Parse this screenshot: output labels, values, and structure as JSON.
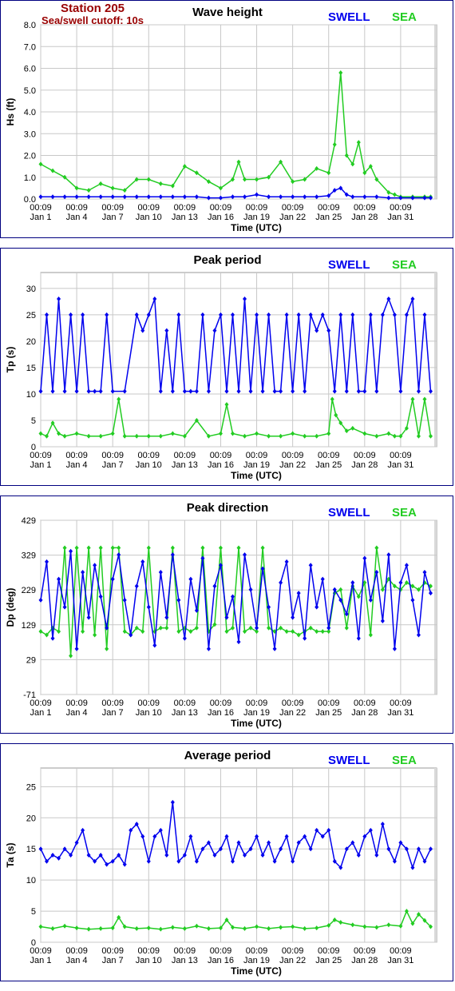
{
  "header": {
    "station": "Station 205",
    "cutoff": "Sea/swell cutoff: 10s"
  },
  "legend": {
    "swell_label": "SWELL",
    "sea_label": "SEA",
    "swell_color": "#0000ee",
    "sea_color": "#22cc22"
  },
  "chart_data": [
    {
      "type": "line",
      "title": "Wave height",
      "ylabel": "Hs (ft)",
      "xlabel": "Time (UTC)",
      "ylim": [
        0,
        8
      ],
      "yticks": [
        "0.0",
        "1.0",
        "2.0",
        "3.0",
        "4.0",
        "5.0",
        "6.0",
        "7.0",
        "8.0"
      ],
      "xticks_time": [
        "00:09",
        "00:09",
        "00:09",
        "00:09",
        "00:09",
        "00:09",
        "00:09",
        "00:09",
        "00:09",
        "00:09",
        "00:09"
      ],
      "xticks_date": [
        "Jan 1",
        "Jan 4",
        "Jan 7",
        "Jan 10",
        "Jan 13",
        "Jan 16",
        "Jan 19",
        "Jan 22",
        "Jan 25",
        "Jan 28",
        "Jan 31"
      ],
      "xlim": [
        1,
        34
      ],
      "series": [
        {
          "name": "SWELL",
          "x": [
            1,
            2,
            3,
            4,
            5,
            6,
            7,
            8,
            9,
            10,
            11,
            12,
            13,
            14,
            15,
            16,
            17,
            18,
            19,
            20,
            21,
            22,
            23,
            24,
            25,
            25.5,
            26,
            26.5,
            27,
            28,
            29,
            30,
            31,
            32,
            33,
            33.5
          ],
          "values": [
            0.1,
            0.1,
            0.1,
            0.1,
            0.1,
            0.1,
            0.1,
            0.1,
            0.1,
            0.1,
            0.1,
            0.1,
            0.1,
            0.1,
            0.05,
            0.05,
            0.1,
            0.1,
            0.2,
            0.1,
            0.1,
            0.1,
            0.1,
            0.1,
            0.15,
            0.4,
            0.5,
            0.2,
            0.1,
            0.1,
            0.1,
            0.05,
            0.05,
            0.05,
            0.05,
            0.05
          ]
        },
        {
          "name": "SEA",
          "x": [
            1,
            2,
            3,
            4,
            5,
            6,
            7,
            8,
            9,
            10,
            11,
            12,
            13,
            14,
            15,
            16,
            17,
            17.5,
            18,
            19,
            20,
            21,
            22,
            23,
            24,
            25,
            25.5,
            26,
            26.5,
            27,
            27.5,
            28,
            28.5,
            29,
            30,
            30.5,
            31,
            32,
            33,
            33.5
          ],
          "values": [
            1.6,
            1.3,
            1.0,
            0.5,
            0.4,
            0.7,
            0.5,
            0.4,
            0.9,
            0.9,
            0.7,
            0.6,
            1.5,
            1.2,
            0.8,
            0.5,
            0.9,
            1.7,
            0.9,
            0.9,
            1.0,
            1.7,
            0.8,
            0.9,
            1.4,
            1.2,
            2.5,
            5.8,
            2.0,
            1.6,
            2.6,
            1.2,
            1.5,
            0.9,
            0.3,
            0.2,
            0.1,
            0.1,
            0.1,
            0.1
          ]
        }
      ]
    },
    {
      "type": "line",
      "title": "Peak period",
      "ylabel": "Tp (s)",
      "xlabel": "Time (UTC)",
      "ylim": [
        0,
        33
      ],
      "yticks": [
        "0",
        "5",
        "10",
        "15",
        "20",
        "25",
        "30"
      ],
      "xticks_time": [
        "00:09",
        "00:09",
        "00:09",
        "00:09",
        "00:09",
        "00:09",
        "00:09",
        "00:09",
        "00:09",
        "00:09",
        "00:09"
      ],
      "xticks_date": [
        "Jan 1",
        "Jan 4",
        "Jan 7",
        "Jan 10",
        "Jan 13",
        "Jan 16",
        "Jan 19",
        "Jan 22",
        "Jan 25",
        "Jan 28",
        "Jan 31"
      ],
      "xlim": [
        1,
        34
      ],
      "series": [
        {
          "name": "SWELL",
          "x": [
            1,
            1.5,
            2,
            2.5,
            3,
            3.5,
            4,
            4.5,
            5,
            5.5,
            6,
            6.5,
            7,
            8,
            9,
            9.5,
            10,
            10.5,
            11,
            11.5,
            12,
            12.5,
            13,
            13.5,
            14,
            14.5,
            15,
            15.5,
            16,
            16.5,
            17,
            17.5,
            18,
            18.5,
            19,
            19.5,
            20,
            20.5,
            21,
            21.5,
            22,
            22.5,
            23,
            23.5,
            24,
            24.5,
            25,
            25.5,
            26,
            26.5,
            27,
            27.5,
            28,
            28.5,
            29,
            29.5,
            30,
            30.5,
            31,
            31.5,
            32,
            32.5,
            33,
            33.5
          ],
          "values": [
            10.5,
            25,
            10.5,
            28,
            10.5,
            25,
            10.5,
            25,
            10.5,
            10.5,
            10.5,
            25,
            10.5,
            10.5,
            25,
            22,
            25,
            28,
            10.5,
            22,
            10.5,
            25,
            10.5,
            10.5,
            10.5,
            25,
            10.5,
            22,
            25,
            10.5,
            25,
            10.5,
            28,
            10.5,
            25,
            10.5,
            25,
            10.5,
            10.5,
            25,
            10.5,
            25,
            10.5,
            25,
            22,
            25,
            22,
            10.5,
            25,
            10.5,
            25,
            10.5,
            10.5,
            25,
            10.5,
            25,
            28,
            25,
            10.5,
            25,
            28,
            10.5,
            25,
            10.5
          ]
        },
        {
          "name": "SEA",
          "x": [
            1,
            1.5,
            2,
            2.5,
            3,
            4,
            5,
            6,
            7,
            7.5,
            8,
            9,
            10,
            11,
            12,
            13,
            14,
            15,
            16,
            16.5,
            17,
            18,
            19,
            20,
            21,
            22,
            23,
            24,
            25,
            25.3,
            25.6,
            26,
            26.5,
            27,
            28,
            29,
            30,
            30.5,
            31,
            31.5,
            32,
            32.5,
            33,
            33.5
          ],
          "values": [
            2.5,
            2,
            4.5,
            2.5,
            2,
            2.5,
            2,
            2,
            2.5,
            9,
            2,
            2,
            2,
            2,
            2.5,
            2,
            5,
            2,
            2.5,
            8,
            2.5,
            2,
            2.5,
            2,
            2,
            2.5,
            2,
            2,
            2.5,
            9,
            6,
            4.5,
            3,
            3.5,
            2.5,
            2,
            2.5,
            2,
            2,
            3.5,
            9,
            2,
            9,
            2
          ]
        }
      ]
    },
    {
      "type": "line",
      "title": "Peak direction",
      "ylabel": "Dp (deg)",
      "xlabel": "Time (UTC)",
      "ylim": [
        -71,
        429
      ],
      "yticks": [
        "-71",
        "29",
        "129",
        "229",
        "329",
        "429"
      ],
      "xticks_time": [
        "00:09",
        "00:09",
        "00:09",
        "00:09",
        "00:09",
        "00:09",
        "00:09",
        "00:09",
        "00:09",
        "00:09",
        "00:09"
      ],
      "xticks_date": [
        "Jan 1",
        "Jan 4",
        "Jan 7",
        "Jan 10",
        "Jan 13",
        "Jan 16",
        "Jan 19",
        "Jan 22",
        "Jan 25",
        "Jan 28",
        "Jan 31"
      ],
      "xlim": [
        1,
        34
      ],
      "series": [
        {
          "name": "SWELL",
          "x": [
            1,
            1.5,
            2,
            2.5,
            3,
            3.5,
            4,
            4.5,
            5,
            5.5,
            6,
            6.5,
            7,
            7.5,
            8,
            8.5,
            9,
            9.5,
            10,
            10.5,
            11,
            11.5,
            12,
            12.5,
            13,
            13.5,
            14,
            14.5,
            15,
            15.5,
            16,
            16.5,
            17,
            17.5,
            18,
            18.5,
            19,
            19.5,
            20,
            20.5,
            21,
            21.5,
            22,
            22.5,
            23,
            23.5,
            24,
            24.5,
            25,
            25.5,
            26,
            26.5,
            27,
            27.5,
            28,
            28.5,
            29,
            29.5,
            30,
            30.5,
            31,
            31.5,
            32,
            32.5,
            33,
            33.5
          ],
          "values": [
            200,
            310,
            90,
            260,
            180,
            340,
            60,
            280,
            150,
            300,
            210,
            120,
            260,
            330,
            200,
            100,
            240,
            310,
            180,
            70,
            280,
            150,
            330,
            200,
            90,
            260,
            170,
            320,
            60,
            240,
            300,
            150,
            210,
            80,
            330,
            230,
            120,
            290,
            180,
            60,
            250,
            310,
            150,
            220,
            90,
            300,
            180,
            260,
            120,
            230,
            200,
            160,
            250,
            90,
            320,
            200,
            280,
            140,
            330,
            60,
            250,
            300,
            200,
            100,
            280,
            220
          ]
        },
        {
          "name": "SEA",
          "x": [
            1,
            1.5,
            2,
            2.5,
            3,
            3.5,
            4,
            4.5,
            5,
            5.5,
            6,
            6.5,
            7,
            7.5,
            8,
            8.5,
            9,
            9.5,
            10,
            10.5,
            11,
            11.5,
            12,
            12.5,
            13,
            13.5,
            14,
            14.5,
            15,
            15.5,
            16,
            16.5,
            17,
            17.5,
            18,
            18.5,
            19,
            19.5,
            20,
            20.5,
            21,
            21.5,
            22,
            22.5,
            23,
            23.5,
            24,
            24.5,
            25,
            25.5,
            26,
            26.5,
            27,
            27.5,
            28,
            28.5,
            29,
            29.5,
            30,
            30.5,
            31,
            31.5,
            32,
            32.5,
            33,
            33.5
          ],
          "values": [
            110,
            100,
            120,
            110,
            350,
            40,
            350,
            110,
            350,
            100,
            350,
            60,
            350,
            350,
            110,
            100,
            120,
            110,
            350,
            110,
            120,
            120,
            350,
            110,
            120,
            110,
            120,
            350,
            110,
            130,
            350,
            110,
            120,
            350,
            110,
            120,
            110,
            350,
            120,
            110,
            120,
            110,
            110,
            100,
            110,
            120,
            110,
            110,
            110,
            220,
            230,
            120,
            240,
            210,
            250,
            100,
            350,
            230,
            260,
            240,
            230,
            250,
            240,
            230,
            250,
            240
          ]
        }
      ]
    },
    {
      "type": "line",
      "title": "Average period",
      "ylabel": "Ta (s)",
      "xlabel": "Time (UTC)",
      "ylim": [
        0,
        28
      ],
      "yticks": [
        "0",
        "5",
        "10",
        "15",
        "20",
        "25"
      ],
      "xticks_time": [
        "00:09",
        "00:09",
        "00:09",
        "00:09",
        "00:09",
        "00:09",
        "00:09",
        "00:09",
        "00:09",
        "00:09",
        "00:09"
      ],
      "xticks_date": [
        "Jan 1",
        "Jan 4",
        "Jan 7",
        "Jan 10",
        "Jan 13",
        "Jan 16",
        "Jan 19",
        "Jan 22",
        "Jan 25",
        "Jan 28",
        "Jan 31"
      ],
      "xlim": [
        1,
        34
      ],
      "series": [
        {
          "name": "SWELL",
          "x": [
            1,
            1.5,
            2,
            2.5,
            3,
            3.5,
            4,
            4.5,
            5,
            5.5,
            6,
            6.5,
            7,
            7.5,
            8,
            8.5,
            9,
            9.5,
            10,
            10.5,
            11,
            11.5,
            12,
            12.5,
            13,
            13.5,
            14,
            14.5,
            15,
            15.5,
            16,
            16.5,
            17,
            17.5,
            18,
            18.5,
            19,
            19.5,
            20,
            20.5,
            21,
            21.5,
            22,
            22.5,
            23,
            23.5,
            24,
            24.5,
            25,
            25.5,
            26,
            26.5,
            27,
            27.5,
            28,
            28.5,
            29,
            29.5,
            30,
            30.5,
            31,
            31.5,
            32,
            32.5,
            33,
            33.5
          ],
          "values": [
            15,
            13,
            14,
            13.5,
            15,
            14,
            16,
            18,
            14,
            13,
            14,
            12.5,
            13,
            14,
            12.5,
            18,
            19,
            17,
            13,
            17,
            18,
            14,
            22.5,
            13,
            14,
            17,
            13,
            15,
            16,
            14,
            15,
            17,
            13,
            16,
            14,
            15,
            17,
            14,
            16,
            13,
            15,
            17,
            13,
            16,
            17,
            15,
            18,
            17,
            18,
            13,
            12,
            15,
            16,
            14,
            17,
            18,
            14,
            19,
            15,
            13,
            16,
            15,
            12,
            15,
            13,
            15
          ]
        },
        {
          "name": "SEA",
          "x": [
            1,
            2,
            3,
            4,
            5,
            6,
            7,
            7.5,
            8,
            9,
            10,
            11,
            12,
            13,
            14,
            15,
            16,
            16.5,
            17,
            18,
            19,
            20,
            21,
            22,
            23,
            24,
            25,
            25.5,
            26,
            27,
            28,
            29,
            30,
            31,
            31.5,
            32,
            32.5,
            33,
            33.5
          ],
          "values": [
            2.5,
            2.2,
            2.6,
            2.3,
            2.1,
            2.2,
            2.3,
            4,
            2.5,
            2.2,
            2.3,
            2.1,
            2.4,
            2.2,
            2.6,
            2.2,
            2.3,
            3.6,
            2.4,
            2.2,
            2.5,
            2.2,
            2.4,
            2.5,
            2.2,
            2.3,
            2.7,
            3.6,
            3.2,
            2.8,
            2.5,
            2.4,
            2.8,
            2.6,
            5,
            3,
            4.5,
            3.5,
            2.5
          ]
        }
      ]
    }
  ]
}
